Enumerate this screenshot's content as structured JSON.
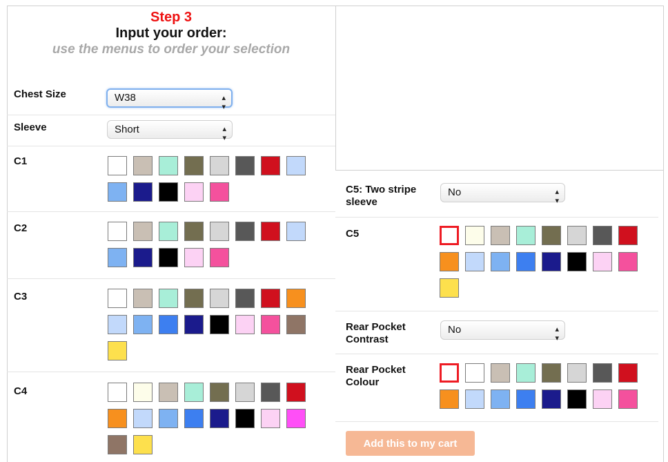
{
  "header": {
    "step": "Step 3",
    "title": "Input your order:",
    "subtitle": "use the menus to order your selection"
  },
  "fields": {
    "chest_size": {
      "label": "Chest Size",
      "value": "W38"
    },
    "sleeve": {
      "label": "Sleeve",
      "value": "Short"
    },
    "c5_two_stripe": {
      "label_line1": "C5: Two stripe",
      "label_line2": "sleeve",
      "value": "No"
    },
    "rear_pocket_contrast": {
      "label_line1": "Rear Pocket",
      "label_line2": "Contrast",
      "value": "No"
    },
    "rear_pocket_colour": {
      "label_line1": "Rear Pocket",
      "label_line2": "Colour"
    }
  },
  "palettes": {
    "c1": {
      "label": "C1",
      "colors": [
        "#ffffff",
        "#c9bfb4",
        "#a8eed8",
        "#736e50",
        "#d6d6d6",
        "#585858",
        "#d0101e",
        "#c2d9fb",
        "#7eb2f2",
        "#1b1b8c",
        "#000000",
        "#fcd2f4",
        "#f4519d"
      ]
    },
    "c2": {
      "label": "C2",
      "colors": [
        "#ffffff",
        "#c9bfb4",
        "#a8eed8",
        "#736e50",
        "#d6d6d6",
        "#585858",
        "#d0101e",
        "#c2d9fb",
        "#7eb2f2",
        "#1b1b8c",
        "#000000",
        "#fcd2f4",
        "#f4519d"
      ]
    },
    "c3": {
      "label": "C3",
      "colors": [
        "#ffffff",
        "#c9bfb4",
        "#a8eed8",
        "#736e50",
        "#d6d6d6",
        "#585858",
        "#d0101e",
        "#f7901e",
        "#c2d9fb",
        "#7eb2f2",
        "#3d7ff0",
        "#1b1b8c",
        "#000000",
        "#fcd2f4",
        "#f4519d",
        "#8f7566",
        "#fde04d"
      ]
    },
    "c4": {
      "label": "C4",
      "colors": [
        "#ffffff",
        "#fdfdea",
        "#c9bfb4",
        "#a8eed8",
        "#736e50",
        "#d6d6d6",
        "#585858",
        "#d0101e",
        "#f7901e",
        "#c2d9fb",
        "#7eb2f2",
        "#3d7ff0",
        "#1b1b8c",
        "#000000",
        "#fcd2f4",
        "#ff4ff7",
        "#8f7566",
        "#fde04d"
      ]
    },
    "c5": {
      "label": "C5",
      "selected_index": 0,
      "colors": [
        "#ffffff",
        "#fdfdea",
        "#c9bfb4",
        "#a8eed8",
        "#736e50",
        "#d6d6d6",
        "#585858",
        "#d0101e",
        "#f7901e",
        "#c2d9fb",
        "#7eb2f2",
        "#3d7ff0",
        "#1b1b8c",
        "#000000",
        "#fcd2f4",
        "#f4519d",
        "#fde04d"
      ]
    },
    "rear_pocket": {
      "selected_index": 0,
      "colors": [
        "#ffffff",
        "#ffffff",
        "#c9bfb4",
        "#a8eed8",
        "#736e50",
        "#d6d6d6",
        "#585858",
        "#d0101e",
        "#f7901e",
        "#c2d9fb",
        "#7eb2f2",
        "#3d7ff0",
        "#1b1b8c",
        "#000000",
        "#fcd2f4",
        "#f4519d"
      ]
    }
  },
  "cart_button": "Add this to my cart"
}
